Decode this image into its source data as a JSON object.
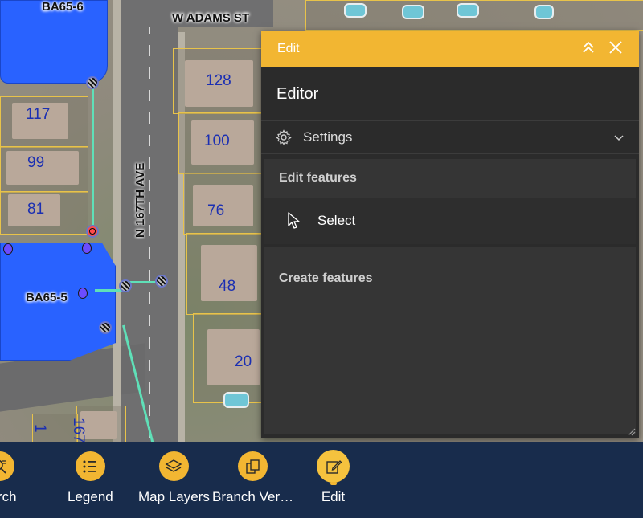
{
  "map": {
    "street_top": "W ADAMS ST",
    "street_vertical": "N 167TH AVE",
    "pond_top_label": "BA65-6",
    "pond_bottom_label": "BA65-5",
    "parcels": [
      "128",
      "117",
      "100",
      "99",
      "81",
      "76",
      "48",
      "20",
      "167",
      "1"
    ]
  },
  "panel": {
    "header_title": "Edit",
    "collapse_icon": "double-chevron-up-icon",
    "close_icon": "close-icon",
    "editor_title": "Editor",
    "settings_label": "Settings",
    "edit_features_label": "Edit features",
    "select_label": "Select",
    "create_features_label": "Create features"
  },
  "toolbar": {
    "items": [
      {
        "label": "earch",
        "icon": "search-icon"
      },
      {
        "label": "Legend",
        "icon": "legend-icon"
      },
      {
        "label": "Map Layers",
        "icon": "layers-icon"
      },
      {
        "label": "Branch Ver…",
        "icon": "branch-versions-icon"
      },
      {
        "label": "Edit",
        "icon": "edit-icon",
        "active": true
      }
    ]
  },
  "colors": {
    "accent": "#f2b632",
    "toolbar_bg": "#182c4c",
    "panel_bg": "#2b2b2b",
    "pond": "#2962ff",
    "pipe": "#5fe0b8"
  }
}
